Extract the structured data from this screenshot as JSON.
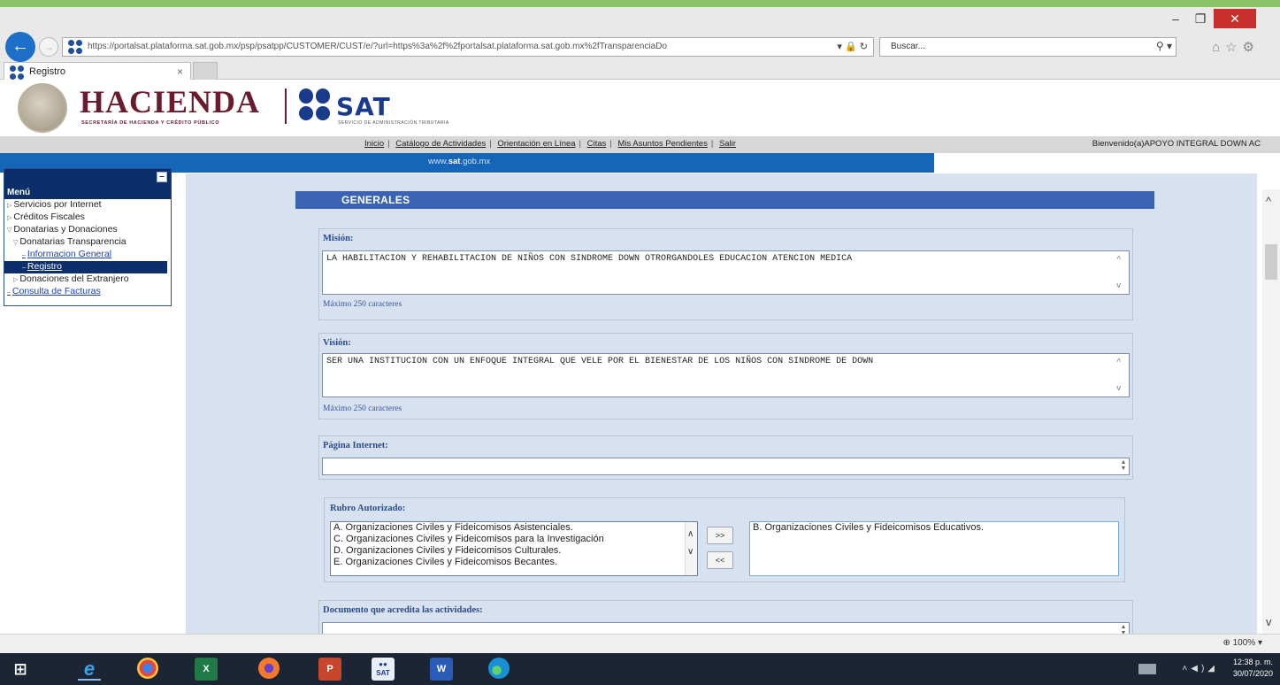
{
  "browser": {
    "url": "https://portalsat.plataforma.sat.gob.mx/psp/psatpp/CUSTOMER/CUST/e/?url=https%3a%2f%2fportalsat.plataforma.sat.gob.mx%2fTransparenciaDo",
    "search_placeholder": "Buscar...",
    "tab_title": "Registro",
    "zoom": "100%"
  },
  "header": {
    "hacienda": "HACIENDA",
    "hacienda_sub": "SECRETARÍA DE HACIENDA Y CRÉDITO PÚBLICO",
    "sat": "SAT",
    "sat_sub": "SERVICIO DE ADMINISTRACIÓN TRIBUTARIA"
  },
  "topnav": {
    "links": [
      "Inicio",
      "Catálogo de Actividades",
      "Orientación en Línea",
      "Citas",
      "Mis Asuntos Pendientes",
      "Salir"
    ],
    "welcome": "Bienvenido(a)APOYO INTEGRAL DOWN AC"
  },
  "bluebar": {
    "prefix": "www.",
    "bold": "sat",
    "suffix": ".gob.mx"
  },
  "sidebar": {
    "title": "Menú",
    "items": [
      {
        "label": "Servicios por Internet"
      },
      {
        "label": "Créditos Fiscales"
      },
      {
        "label": "Donatarias y Donaciones"
      },
      {
        "label": "Donatarias Transparencia"
      },
      {
        "label": "Informacion General"
      },
      {
        "label": "Registro"
      },
      {
        "label": "Donaciones del Extranjero"
      },
      {
        "label": "Consulta de Facturas"
      }
    ]
  },
  "form": {
    "section_title": "GENERALES",
    "mision_label": "Misión:",
    "mision_value": "LA HABILITACION Y REHABILITACION DE NIÑOS CON SINDROME DOWN OTRORGANDOLES EDUCACION ATENCION MEDICA",
    "mision_hint": "Máximo 250 caracteres",
    "vision_label": "Visión:",
    "vision_value": "SER UNA INSTITUCION CON UN ENFOQUE INTEGRAL QUE VELE POR EL BIENESTAR DE LOS NIÑOS CON SINDROME DE DOWN",
    "vision_hint": "Máximo 250 caracteres",
    "pagina_label": "Página Internet:",
    "pagina_value": "",
    "rubro_label": "Rubro Autorizado:",
    "rubro_available": [
      "A. Organizaciones Civiles y Fideicomisos Asistenciales.",
      "C. Organizaciones Civiles y Fideicomisos para la Investigación",
      "D. Organizaciones Civiles y Fideicomisos Culturales.",
      "E. Organizaciones Civiles y Fideicomisos Becantes."
    ],
    "rubro_selected": [
      "B. Organizaciones Civiles y Fideicomisos Educativos."
    ],
    "add_label": ">>",
    "remove_label": "<<",
    "documento_label": "Documento que acredita las actividades:"
  },
  "taskbar": {
    "time": "12:38 p. m.",
    "date": "30/07/2020"
  }
}
